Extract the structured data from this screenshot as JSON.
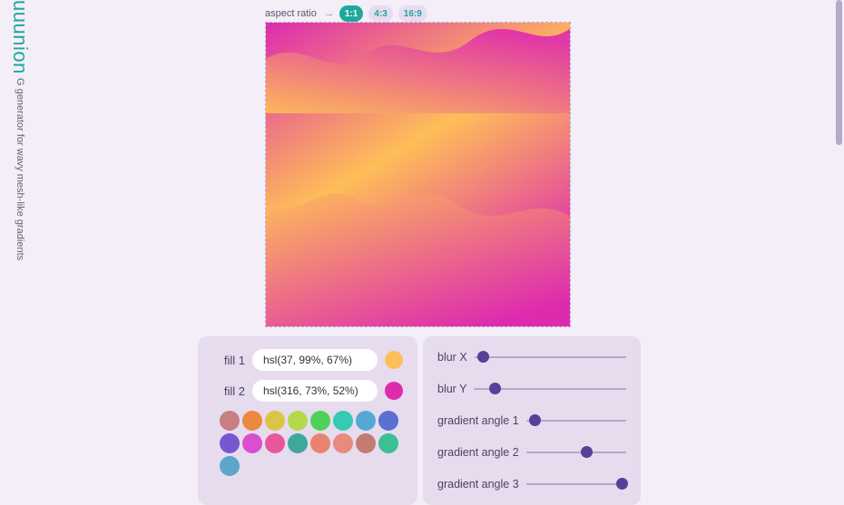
{
  "sidebar": {
    "main": "uuunion",
    "sub": "G generator for wavy mesh-like gradients"
  },
  "aspect": {
    "label": "aspect ratio",
    "arrow": "→",
    "options": [
      "1:1",
      "4:3",
      "16:9"
    ],
    "active": 0
  },
  "canvas": {
    "fill1": "hsl(37, 99%, 67%)",
    "fill2": "hsl(316, 73%, 52%)"
  },
  "fills": {
    "label1": "fill 1",
    "value1": "hsl(37, 99%, 67%)",
    "label2": "fill 2",
    "value2": "hsl(316, 73%, 52%)"
  },
  "palette": [
    "#c77f82",
    "#eb8a3e",
    "#dcc446",
    "#b4d94a",
    "#4ed158",
    "#37c9b3",
    "#55a8d4",
    "#5c6fd4",
    "#7857d1",
    "#d94fd0",
    "#e6579b",
    "#3fa89c",
    "#e8846e",
    "#e88a7f",
    "#c37b73",
    "#3cbf94",
    "#5ea5c9"
  ],
  "sliders": {
    "blurX": {
      "label": "blur X",
      "pos": 2
    },
    "blurY": {
      "label": "blur Y",
      "pos": 10
    },
    "g1": {
      "label": "gradient angle 1",
      "pos": 3
    },
    "g2": {
      "label": "gradient angle 2",
      "pos": 55
    },
    "g3": {
      "label": "gradient angle 3",
      "pos": 95
    }
  }
}
